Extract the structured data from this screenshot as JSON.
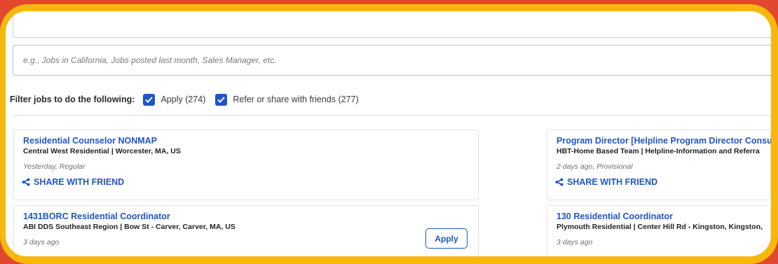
{
  "search": {
    "placeholder": "e.g., Jobs in California, Jobs posted last month, Sales Manager, etc."
  },
  "filter": {
    "label": "Filter jobs to do the following:",
    "options": [
      {
        "label": "Apply (274)",
        "checked": true
      },
      {
        "label": "Refer or share with friends (277)",
        "checked": true
      }
    ]
  },
  "jobs": [
    {
      "title": "Residential Counselor NONMAP",
      "meta": "Central West Residential | Worcester, MA, US",
      "posted": "Yesterday, Regular",
      "share_label": "SHARE WITH FRIEND"
    },
    {
      "title": "Program Director [Helpline Program Director Consu",
      "meta": "HBT-Home Based Team | Helpline-Information and Referra",
      "posted": "2 days ago, Provisional",
      "share_label": "SHARE WITH FRIEND"
    },
    {
      "title": "1431BORC Residential Coordinator",
      "meta": "ABI DDS Southeast Region | Bow St - Carver, Carver, MA, US",
      "posted": "3 days ago",
      "apply_label": "Apply"
    },
    {
      "title": "130 Residential Coordinator",
      "meta": "Plymouth Residential | Center Hill Rd - Kingston, Kingston,",
      "posted": "3 days ago"
    }
  ],
  "colors": {
    "accent": "#1F56C6",
    "border_outer": "#E3472E",
    "border_inner": "#F6B80E"
  }
}
